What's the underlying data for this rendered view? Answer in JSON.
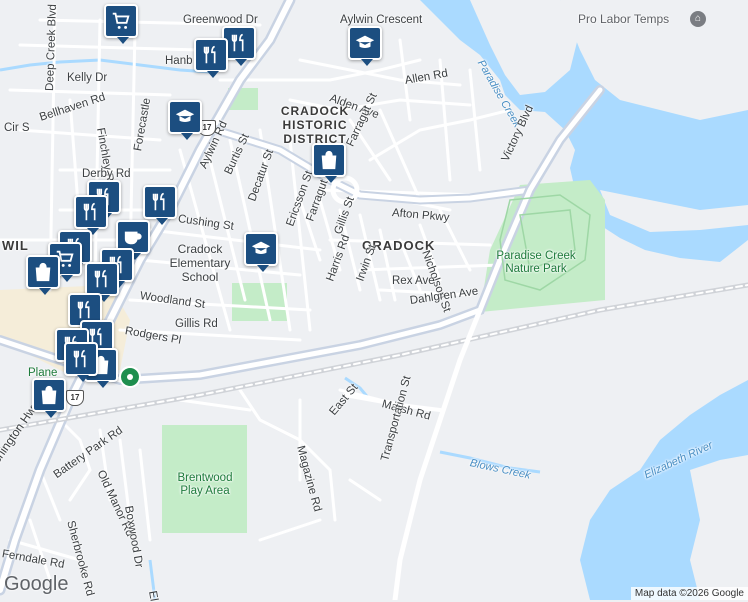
{
  "map": {
    "colors": {
      "land": "#eef0f3",
      "water": "#aadaff",
      "park": "#c4ecc8",
      "road": "#ffffff",
      "highway": "#c9d3e3",
      "pin": "#1c4e80"
    },
    "labels": {
      "greenwood": "Greenwood Dr",
      "aylwin_crescent": "Aylwin Crescent",
      "pro_labor": "Pro Labor Temps",
      "deep_creek": "Deep Creek Blvd",
      "kelly": "Kelly Dr",
      "hanb": "Hanb",
      "allen": "Allen Rd",
      "alden": "Alden Ave",
      "cradock_district": "CRADOCK HISTORIC DISTRICT",
      "paradise_creek": "Paradise Creek",
      "bellhaven": "Bellhaven Rd",
      "cir": "Cir S",
      "finchley": "Finchley Rd",
      "forecastle": "Forecastle",
      "aylwin": "Aylwin Rd",
      "burtis": "Burtis St",
      "farragut_n": "Farragut St",
      "victory": "Victory Blvd",
      "derby": "Derby Rd",
      "decatur": "Decatur St",
      "ericsson": "Ericsson St",
      "farragut_s": "Farragut St",
      "gillis_st": "Gillis St",
      "afton": "Afton Pkwy",
      "cushing": "Cushing St",
      "cradock": "CRADOCK",
      "nicholson": "Nicholson St",
      "paradise_park": "Paradise Creek Nature Park",
      "cradock_elem": "Cradock Elementary School",
      "wil": "WIL",
      "harris": "Harris Rd",
      "irwin": "Irwin St",
      "rex": "Rex Ave",
      "woodland": "Woodland St",
      "dahlgren": "Dahlgren Ave",
      "gillis_rd": "Gillis Rd",
      "rodgers": "Rodgers Pl",
      "plane": "Plane",
      "marsh": "Marsh Rd",
      "east": "East St",
      "magazine": "Magazine Rd",
      "transportation": "Transportation St",
      "blows": "Blows Creek",
      "elizabeth": "Elizabeth River",
      "battery": "Battery Park Rd",
      "old_manor": "Old Manor Rd",
      "boxwood": "Boxwood Dr",
      "brentwood": "Brentwood Play Area",
      "sherbrooke": "Sherbrooke Rd",
      "washington": "Washington Hwy N",
      "ferndale": "Ferndale Rd",
      "el": "El"
    },
    "route_shield": "17",
    "attribution": "Map data ©2026 Google",
    "logo": "Google"
  }
}
